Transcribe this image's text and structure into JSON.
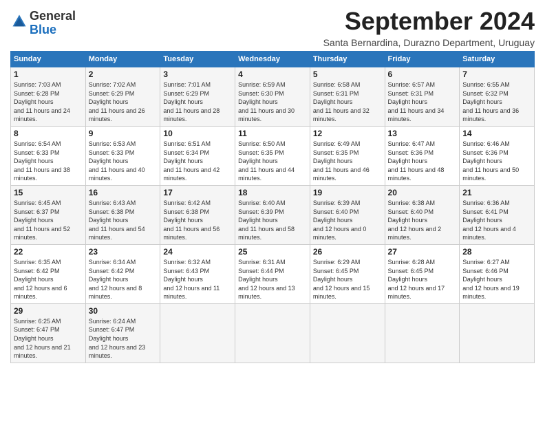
{
  "header": {
    "logo_general": "General",
    "logo_blue": "Blue",
    "month_title": "September 2024",
    "subtitle": "Santa Bernardina, Durazno Department, Uruguay"
  },
  "days_of_week": [
    "Sunday",
    "Monday",
    "Tuesday",
    "Wednesday",
    "Thursday",
    "Friday",
    "Saturday"
  ],
  "weeks": [
    [
      {
        "day": 1,
        "sunrise": "7:03 AM",
        "sunset": "6:28 PM",
        "daylight": "11 hours and 24 minutes."
      },
      {
        "day": 2,
        "sunrise": "7:02 AM",
        "sunset": "6:29 PM",
        "daylight": "11 hours and 26 minutes."
      },
      {
        "day": 3,
        "sunrise": "7:01 AM",
        "sunset": "6:29 PM",
        "daylight": "11 hours and 28 minutes."
      },
      {
        "day": 4,
        "sunrise": "6:59 AM",
        "sunset": "6:30 PM",
        "daylight": "11 hours and 30 minutes."
      },
      {
        "day": 5,
        "sunrise": "6:58 AM",
        "sunset": "6:31 PM",
        "daylight": "11 hours and 32 minutes."
      },
      {
        "day": 6,
        "sunrise": "6:57 AM",
        "sunset": "6:31 PM",
        "daylight": "11 hours and 34 minutes."
      },
      {
        "day": 7,
        "sunrise": "6:55 AM",
        "sunset": "6:32 PM",
        "daylight": "11 hours and 36 minutes."
      }
    ],
    [
      {
        "day": 8,
        "sunrise": "6:54 AM",
        "sunset": "6:33 PM",
        "daylight": "11 hours and 38 minutes."
      },
      {
        "day": 9,
        "sunrise": "6:53 AM",
        "sunset": "6:33 PM",
        "daylight": "11 hours and 40 minutes."
      },
      {
        "day": 10,
        "sunrise": "6:51 AM",
        "sunset": "6:34 PM",
        "daylight": "11 hours and 42 minutes."
      },
      {
        "day": 11,
        "sunrise": "6:50 AM",
        "sunset": "6:35 PM",
        "daylight": "11 hours and 44 minutes."
      },
      {
        "day": 12,
        "sunrise": "6:49 AM",
        "sunset": "6:35 PM",
        "daylight": "11 hours and 46 minutes."
      },
      {
        "day": 13,
        "sunrise": "6:47 AM",
        "sunset": "6:36 PM",
        "daylight": "11 hours and 48 minutes."
      },
      {
        "day": 14,
        "sunrise": "6:46 AM",
        "sunset": "6:36 PM",
        "daylight": "11 hours and 50 minutes."
      }
    ],
    [
      {
        "day": 15,
        "sunrise": "6:45 AM",
        "sunset": "6:37 PM",
        "daylight": "11 hours and 52 minutes."
      },
      {
        "day": 16,
        "sunrise": "6:43 AM",
        "sunset": "6:38 PM",
        "daylight": "11 hours and 54 minutes."
      },
      {
        "day": 17,
        "sunrise": "6:42 AM",
        "sunset": "6:38 PM",
        "daylight": "11 hours and 56 minutes."
      },
      {
        "day": 18,
        "sunrise": "6:40 AM",
        "sunset": "6:39 PM",
        "daylight": "11 hours and 58 minutes."
      },
      {
        "day": 19,
        "sunrise": "6:39 AM",
        "sunset": "6:40 PM",
        "daylight": "12 hours and 0 minutes."
      },
      {
        "day": 20,
        "sunrise": "6:38 AM",
        "sunset": "6:40 PM",
        "daylight": "12 hours and 2 minutes."
      },
      {
        "day": 21,
        "sunrise": "6:36 AM",
        "sunset": "6:41 PM",
        "daylight": "12 hours and 4 minutes."
      }
    ],
    [
      {
        "day": 22,
        "sunrise": "6:35 AM",
        "sunset": "6:42 PM",
        "daylight": "12 hours and 6 minutes."
      },
      {
        "day": 23,
        "sunrise": "6:34 AM",
        "sunset": "6:42 PM",
        "daylight": "12 hours and 8 minutes."
      },
      {
        "day": 24,
        "sunrise": "6:32 AM",
        "sunset": "6:43 PM",
        "daylight": "12 hours and 11 minutes."
      },
      {
        "day": 25,
        "sunrise": "6:31 AM",
        "sunset": "6:44 PM",
        "daylight": "12 hours and 13 minutes."
      },
      {
        "day": 26,
        "sunrise": "6:29 AM",
        "sunset": "6:45 PM",
        "daylight": "12 hours and 15 minutes."
      },
      {
        "day": 27,
        "sunrise": "6:28 AM",
        "sunset": "6:45 PM",
        "daylight": "12 hours and 17 minutes."
      },
      {
        "day": 28,
        "sunrise": "6:27 AM",
        "sunset": "6:46 PM",
        "daylight": "12 hours and 19 minutes."
      }
    ],
    [
      {
        "day": 29,
        "sunrise": "6:25 AM",
        "sunset": "6:47 PM",
        "daylight": "12 hours and 21 minutes."
      },
      {
        "day": 30,
        "sunrise": "6:24 AM",
        "sunset": "6:47 PM",
        "daylight": "12 hours and 23 minutes."
      },
      null,
      null,
      null,
      null,
      null
    ]
  ]
}
